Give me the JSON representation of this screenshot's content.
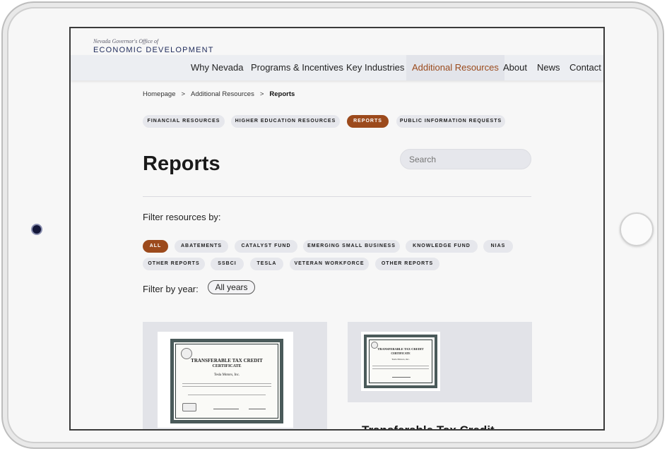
{
  "logo": {
    "top_text": "Nevada Governor's Office of",
    "main_text": "ECONOMIC DEVELOPMENT"
  },
  "nav": {
    "items": [
      {
        "label": "Why Nevada"
      },
      {
        "label": "Programs & Incentives"
      },
      {
        "label": "Key Industries"
      },
      {
        "label": "Additional Resources"
      },
      {
        "label": "About"
      },
      {
        "label": "News"
      },
      {
        "label": "Contact"
      }
    ],
    "active": "Additional Resources"
  },
  "breadcrumb": {
    "home": "Homepage",
    "parent": "Additional Resources",
    "current": "Reports",
    "separator": ">"
  },
  "category_tabs": [
    {
      "label": "FINANCIAL RESOURCES"
    },
    {
      "label": "HIGHER EDUCATION RESOURCES"
    },
    {
      "label": "REPORTS"
    },
    {
      "label": "PUBLIC INFORMATION REQUESTS"
    }
  ],
  "page_title": "Reports",
  "search": {
    "placeholder": "Search"
  },
  "filters": {
    "label": "Filter resources by:",
    "options": [
      {
        "label": "ALL"
      },
      {
        "label": "ABATEMENTS"
      },
      {
        "label": "CATALYST FUND"
      },
      {
        "label": "EMERGING SMALL BUSINESS"
      },
      {
        "label": "KNOWLEDGE FUND"
      },
      {
        "label": "NIAS"
      },
      {
        "label": "OTHER REPORTS"
      },
      {
        "label": "SSBCI"
      },
      {
        "label": "TESLA"
      },
      {
        "label": "VETERAN WORKFORCE"
      },
      {
        "label": "OTHER REPORTS"
      }
    ],
    "active": "ALL"
  },
  "year_filter": {
    "label": "Filter by year:",
    "selected": "All years"
  },
  "cards": [
    {
      "certificate": {
        "heading_1": "TRANSFERABLE TAX CREDIT",
        "heading_2": "CERTIFICATE",
        "recipient": "Tesla Motors, Inc."
      }
    },
    {
      "certificate": {
        "heading_1": "TRANSFERABLE TAX CREDIT",
        "heading_2": "CERTIFICATE",
        "recipient": "Tesla Motors, Inc."
      },
      "title": "Transferable Tax Credit"
    }
  ],
  "colors": {
    "accent": "#9c4a1c",
    "pill_background": "#e6e7ec",
    "nav_background": "#eceef2",
    "logo_navy": "#1e2a5a",
    "card_background": "#e2e3e8"
  },
  "icons": {
    "camera": "front-camera-icon",
    "home_button": "home-button-icon"
  }
}
